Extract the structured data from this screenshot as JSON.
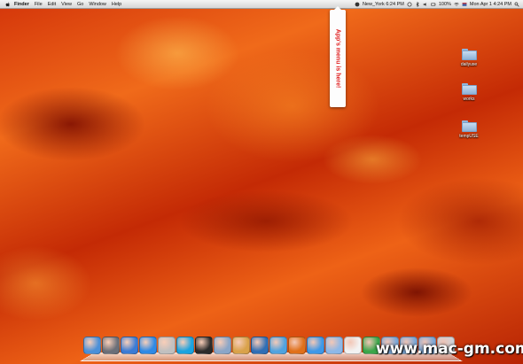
{
  "menubar": {
    "items": [
      "Finder",
      "File",
      "Edit",
      "View",
      "Go",
      "Window",
      "Help"
    ],
    "status": {
      "clock_city": "New_York 6:24 PM",
      "battery": "100%",
      "datetime": "Mon Apr 1  4:24 PM"
    }
  },
  "callout": {
    "text": "App's menu is here!"
  },
  "desktop": {
    "folders": [
      {
        "label": "dailyuse"
      },
      {
        "label": "works"
      },
      {
        "label": "tempUSE"
      }
    ]
  },
  "dock": {
    "apps": [
      {
        "icon": "finder-icon",
        "color": "#4a90d9"
      },
      {
        "icon": "launchpad-icon",
        "color": "#6b6f78"
      },
      {
        "icon": "itunes-icon",
        "color": "#3a7bd5"
      },
      {
        "icon": "app-store-icon",
        "color": "#2e8ae6"
      },
      {
        "icon": "photo-booth-icon",
        "color": "#c0c0c0"
      },
      {
        "icon": "skype-icon",
        "color": "#19a3e0"
      },
      {
        "icon": "dashboard-icon",
        "color": "#2b2b2b"
      },
      {
        "icon": "preview-icon",
        "color": "#8aa6c8"
      },
      {
        "icon": "xcode-icon",
        "color": "#d9a24a"
      },
      {
        "icon": "google-earth-icon",
        "color": "#2f6eb5"
      },
      {
        "icon": "safari-icon",
        "color": "#4fa3e0"
      },
      {
        "icon": "firefox-icon",
        "color": "#e0701a"
      },
      {
        "icon": "messages-icon",
        "color": "#3d98e8"
      },
      {
        "icon": "mail-icon",
        "color": "#8cb8e8"
      },
      {
        "icon": "textedit-icon",
        "color": "#f2f2f2"
      },
      {
        "icon": "numbers-icon",
        "color": "#3aa64a"
      },
      {
        "icon": "applications-folder-icon",
        "color": "#7aa7d8"
      },
      {
        "icon": "documents-folder-icon",
        "color": "#7aa7d8"
      },
      {
        "icon": "downloads-folder-icon",
        "color": "#7aa7d8"
      },
      {
        "icon": "trash-icon",
        "color": "#cfd3d8"
      }
    ]
  },
  "watermark": {
    "text": "www.mac-gm.com"
  }
}
